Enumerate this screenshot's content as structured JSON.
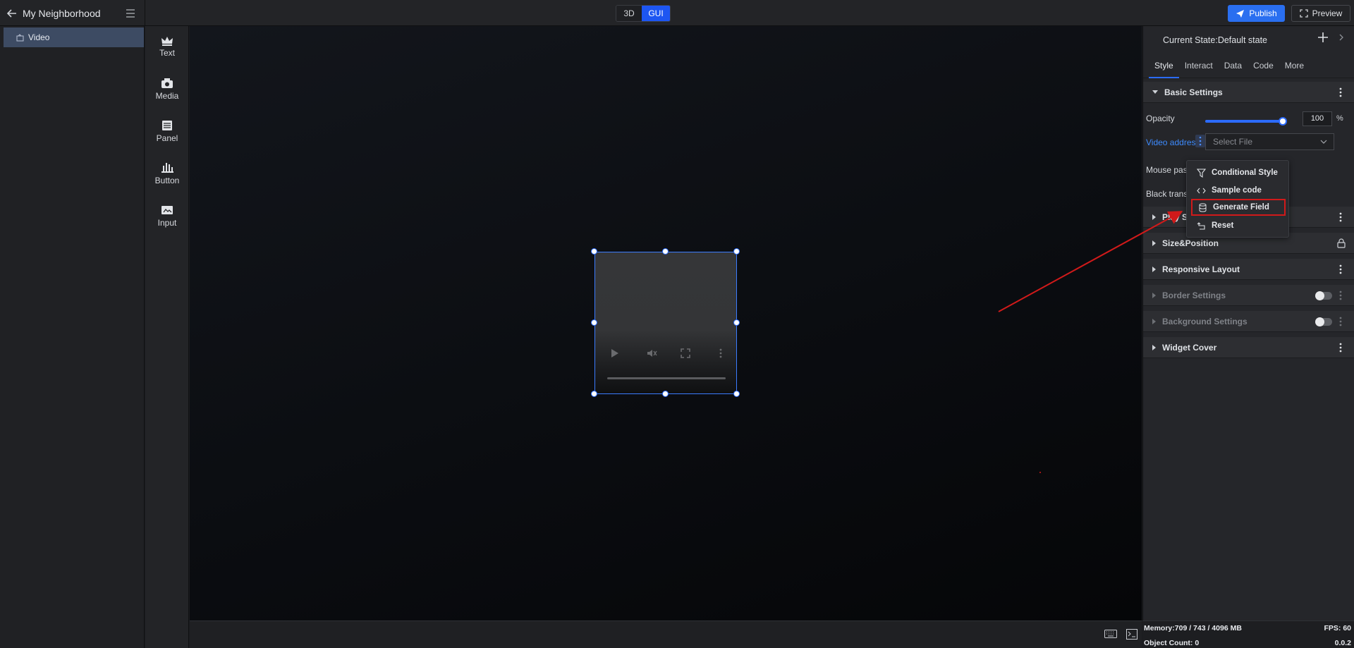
{
  "topbar": {
    "project_name": "My Neighborhood",
    "mode_3d": "3D",
    "mode_gui": "GUI",
    "publish_label": "Publish",
    "preview_label": "Preview"
  },
  "tree": {
    "items": [
      {
        "label": "Video"
      }
    ]
  },
  "palette": {
    "items": [
      {
        "label": "Text"
      },
      {
        "label": "Media"
      },
      {
        "label": "Panel"
      },
      {
        "label": "Button"
      },
      {
        "label": "Input"
      }
    ]
  },
  "panel": {
    "current_state": "Current State:Default state",
    "tabs": [
      {
        "label": "Style"
      },
      {
        "label": "Interact"
      },
      {
        "label": "Data"
      },
      {
        "label": "Code"
      },
      {
        "label": "More"
      }
    ],
    "basic_settings": {
      "title": "Basic Settings",
      "opacity_label": "Opacity",
      "opacity_value": "100",
      "opacity_unit": "%",
      "opacity_fraction": 1.0,
      "video_address_label": "Video address",
      "select_file_placeholder": "Select File",
      "mouse_pass_label": "Mouse pass",
      "black_trans_label": "Black trans"
    },
    "sections": [
      {
        "label": "Play S"
      },
      {
        "label": "Size&Position"
      },
      {
        "label": "Responsive Layout"
      },
      {
        "label": "Border Settings"
      },
      {
        "label": "Background Settings"
      },
      {
        "label": "Widget Cover"
      }
    ]
  },
  "dropdown": {
    "items": [
      {
        "label": "Conditional Style",
        "icon": "filter-icon"
      },
      {
        "label": "Sample code",
        "icon": "code-icon"
      },
      {
        "label": "Generate Field",
        "icon": "database-icon"
      },
      {
        "label": "Reset",
        "icon": "reset-icon"
      }
    ],
    "highlight_color": "#d11a1a"
  },
  "status": {
    "memory": "Memory:709 / 743 / 4096 MB",
    "fps": "FPS: 60",
    "object_count": "Object Count: 0",
    "version": "0.0.2"
  },
  "colors": {
    "accent": "#2b6cff",
    "annotation": "#d11a1a"
  }
}
